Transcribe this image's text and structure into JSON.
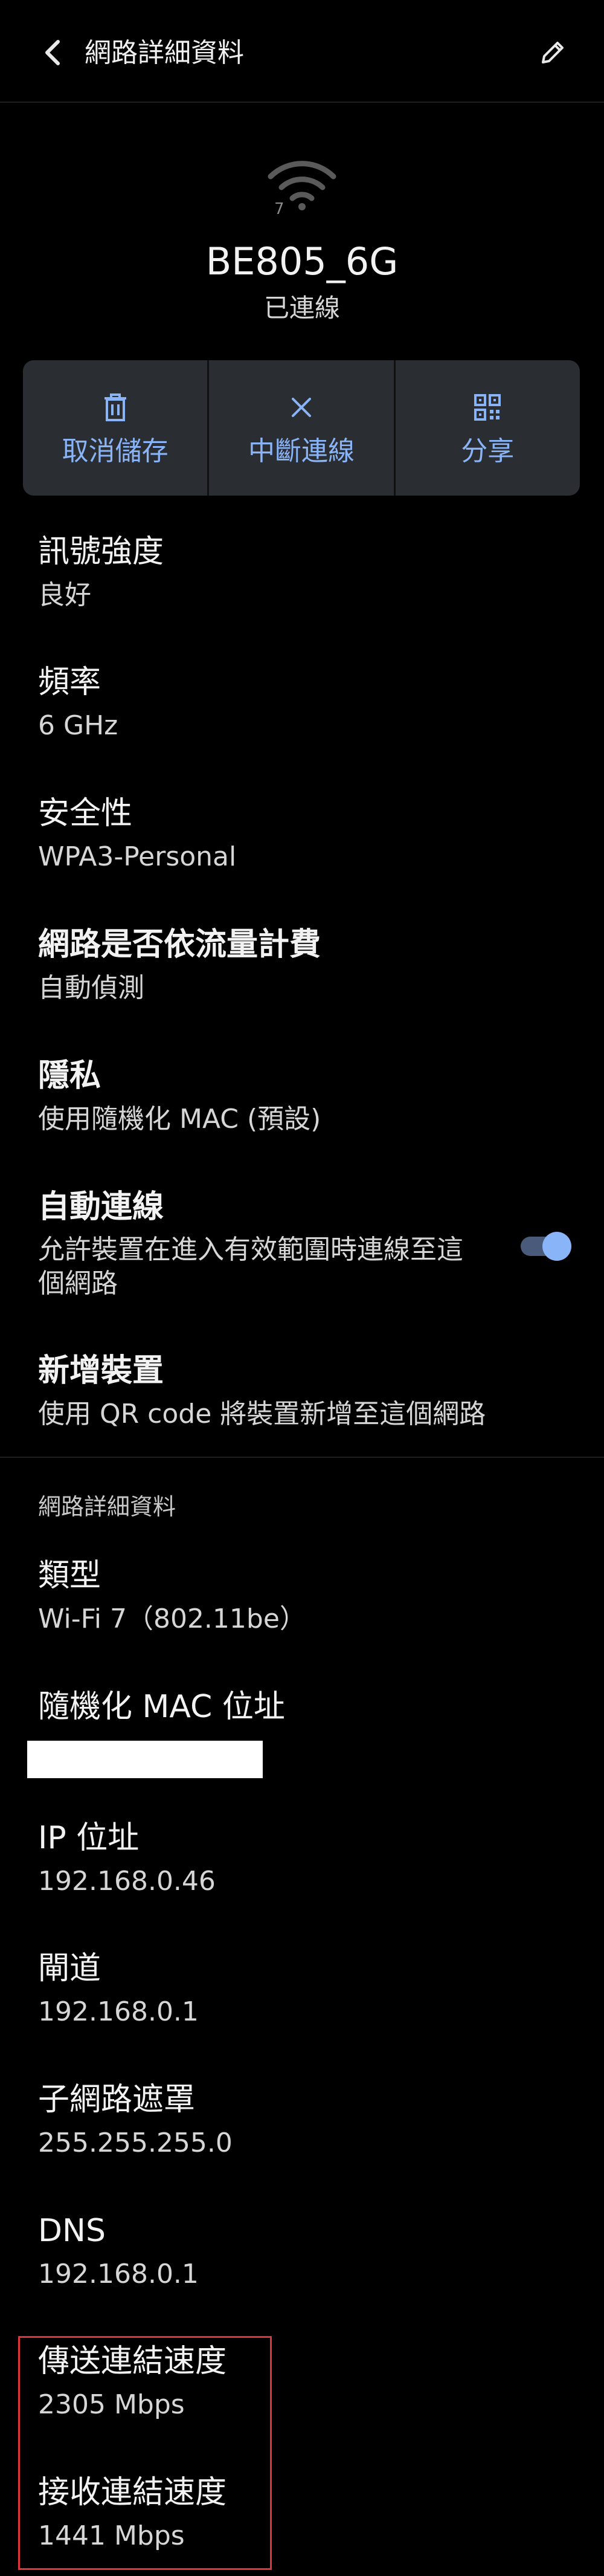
{
  "header": {
    "title": "網路詳細資料"
  },
  "network": {
    "ssid": "BE805_6G",
    "status": "已連線",
    "wifi_icon_badge": "7"
  },
  "actions": {
    "forget_label": "取消儲存",
    "disconnect_label": "中斷連線",
    "share_label": "分享"
  },
  "details": {
    "signal_title": "訊號強度",
    "signal_value": "良好",
    "frequency_title": "頻率",
    "frequency_value": "6 GHz",
    "security_title": "安全性",
    "security_value": "WPA3-Personal",
    "metered_title": "網路是否依流量計費",
    "metered_value": "自動偵測",
    "privacy_title": "隱私",
    "privacy_value": "使用隨機化 MAC (預設)",
    "autoconnect_title": "自動連線",
    "autoconnect_desc": "允許裝置在進入有效範圍時連線至這個網路",
    "autoconnect_enabled": true,
    "add_device_title": "新增裝置",
    "add_device_desc": "使用 QR code 將裝置新增至這個網路"
  },
  "network_details": {
    "section_header": "網路詳細資料",
    "type_title": "類型",
    "type_value": "Wi-Fi 7（802.11be）",
    "mac_title": "隨機化 MAC 位址",
    "ip_title": "IP 位址",
    "ip_value": "192.168.0.46",
    "gateway_title": "閘道",
    "gateway_value": "192.168.0.1",
    "subnet_title": "子網路遮罩",
    "subnet_value": "255.255.255.0",
    "dns_title": "DNS",
    "dns_value": "192.168.0.1",
    "tx_title": "傳送連結速度",
    "tx_value": "2305 Mbps",
    "rx_title": "接收連結速度",
    "rx_value": "1441 Mbps"
  },
  "colors": {
    "background": "#000000",
    "accent": "#8ab4f8",
    "action_bar": "#2a2d31",
    "highlight": "#e0343c"
  },
  "icons": {
    "back": "back-arrow-icon",
    "edit": "pencil-icon",
    "wifi": "wifi-icon",
    "forget": "trash-icon",
    "disconnect": "close-icon",
    "share": "qr-code-icon"
  }
}
